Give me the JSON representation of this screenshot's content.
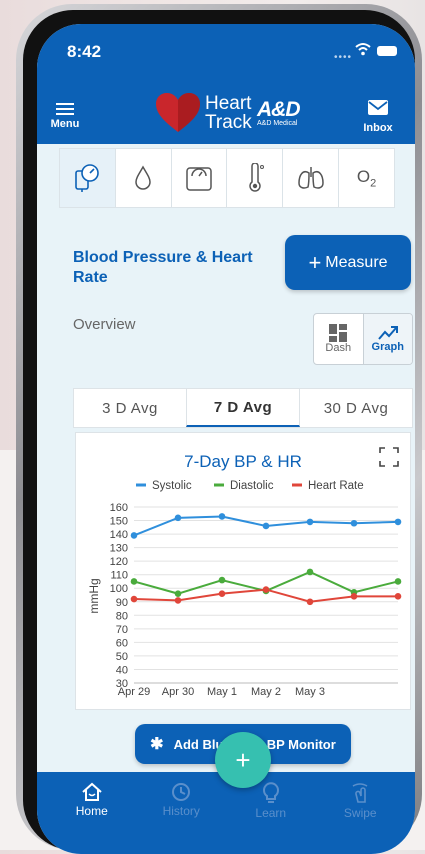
{
  "status_bar": {
    "time": "8:42"
  },
  "app_bar": {
    "menu_label": "Menu",
    "logo_line1": "Heart",
    "logo_line2": "Track",
    "brand_name": "A&D",
    "brand_sub": "A&D Medical",
    "inbox_label": "Inbox"
  },
  "category_icons": [
    "blood-pressure-icon",
    "droplet-icon",
    "scale-icon",
    "thermometer-icon",
    "lungs-icon",
    "oxygen-icon"
  ],
  "oxygen_label": {
    "main": "O",
    "sub": "2"
  },
  "section": {
    "title": "Blood Pressure & Heart Rate",
    "measure_plus": "+",
    "measure_label": "Measure"
  },
  "overview": {
    "label": "Overview",
    "dash_label": "Dash",
    "graph_label": "Graph",
    "selected": "Graph"
  },
  "avg_tabs": [
    "3 D Avg",
    "7 D Avg",
    "30 D Avg"
  ],
  "selected_avg_tab": "7 D Avg",
  "bluetooth_button": {
    "label": "Add Bluetooth BP Monitor"
  },
  "fab_label": "+",
  "bottom_nav": [
    {
      "label": "Home",
      "icon": "home-icon",
      "selected": true
    },
    {
      "label": "History",
      "icon": "history-icon",
      "selected": false
    },
    {
      "label": "Learn",
      "icon": "lightbulb-icon",
      "selected": false
    },
    {
      "label": "Swipe",
      "icon": "swipe-icon",
      "selected": false
    }
  ],
  "colors": {
    "primary": "#0c61b6",
    "systolic": "#2f8fdc",
    "diastolic": "#4aab3c",
    "heart_rate": "#e0463a",
    "fab": "#36c0b0"
  },
  "chart_data": {
    "type": "line",
    "title": "7-Day BP & HR",
    "ylabel": "mmHg",
    "ylim": [
      30,
      160
    ],
    "yticks": [
      30,
      40,
      50,
      60,
      70,
      80,
      90,
      100,
      110,
      120,
      130,
      140,
      150,
      160
    ],
    "x": [
      "Apr 29",
      "Apr 30",
      "May 1",
      "May 2",
      "May 3",
      "",
      ""
    ],
    "legend_position": "top",
    "grid": true,
    "series": [
      {
        "name": "Systolic",
        "color": "#2f8fdc",
        "values": [
          139,
          152,
          153,
          146,
          149,
          148,
          149
        ]
      },
      {
        "name": "Diastolic",
        "color": "#4aab3c",
        "values": [
          105,
          96,
          106,
          98,
          112,
          97,
          105
        ]
      },
      {
        "name": "Heart Rate",
        "color": "#e0463a",
        "values": [
          92,
          91,
          96,
          99,
          90,
          94,
          94
        ]
      }
    ]
  }
}
